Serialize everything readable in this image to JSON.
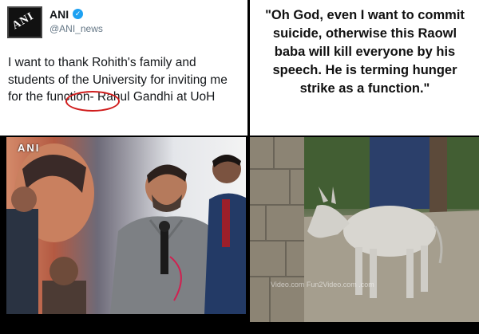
{
  "tweet": {
    "account_name": "ANI",
    "handle": "@ANI_news",
    "avatar_text": "ANI",
    "text_before": "I want to thank Rohith's family and students of the University for inviting me for the ",
    "highlight": "function",
    "text_after": "- Rahul Gandhi at UoH"
  },
  "photo_left": {
    "watermark": "ANI"
  },
  "quote": {
    "text": "\"Oh God, even I want to commit suicide, otherwise this Raowl baba will kill everyone by his speech. He is  terming hunger strike as a function.\""
  },
  "photo_right": {
    "watermark": "Video.com   Fun2Video.com   .com"
  },
  "colors": {
    "circle": "#d01c1c",
    "verified": "#1da1f2",
    "panel_bg": "#000000"
  }
}
